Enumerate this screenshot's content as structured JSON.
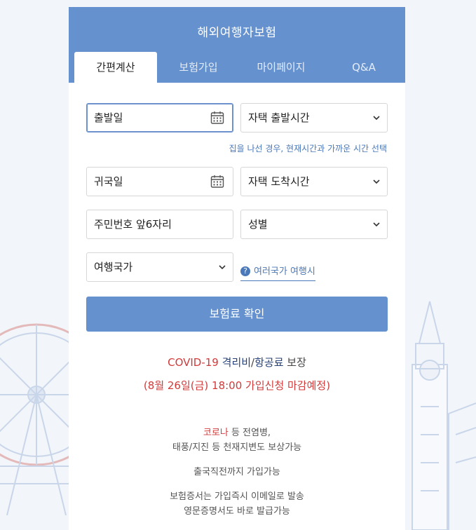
{
  "header": {
    "title": "해외여행자보험"
  },
  "tabs": [
    {
      "label": "간편계산"
    },
    {
      "label": "보험가입"
    },
    {
      "label": "마이페이지"
    },
    {
      "label": "Q&A"
    }
  ],
  "form": {
    "depart_date_placeholder": "출발일",
    "depart_time": "자택 출발시간",
    "hint": "집을 나선 경우, 현재시간과 가까운 시간 선택",
    "return_date_placeholder": "귀국일",
    "arrive_time": "자택 도착시간",
    "rrn_placeholder": "주민번호 앞6자리",
    "gender": "성별",
    "country": "여행국가",
    "multi_country_link": "여러국가 여행시",
    "submit": "보험료 확인"
  },
  "promo": {
    "covid": "COVID-19",
    "isolation": "격리비",
    "slash": "/",
    "airfare": "항공료",
    "coverage": "보장",
    "deadline": "(8월 26일(금) 18:00 가입신청 마감예정)"
  },
  "notes": {
    "corona": "코로나",
    "line1_rest": "등 전염병,",
    "line2": "태풍/지진 등 천재지변도 보상가능",
    "line3": "출국직전까지 가입가능",
    "line4": "보험증서는 가입즉시 이메일로 발송",
    "line5": "영문증명서도 바로 발급가능"
  },
  "colors": {
    "accent": "#6592cf",
    "red": "#d23a3a",
    "link": "#4a78b8"
  }
}
